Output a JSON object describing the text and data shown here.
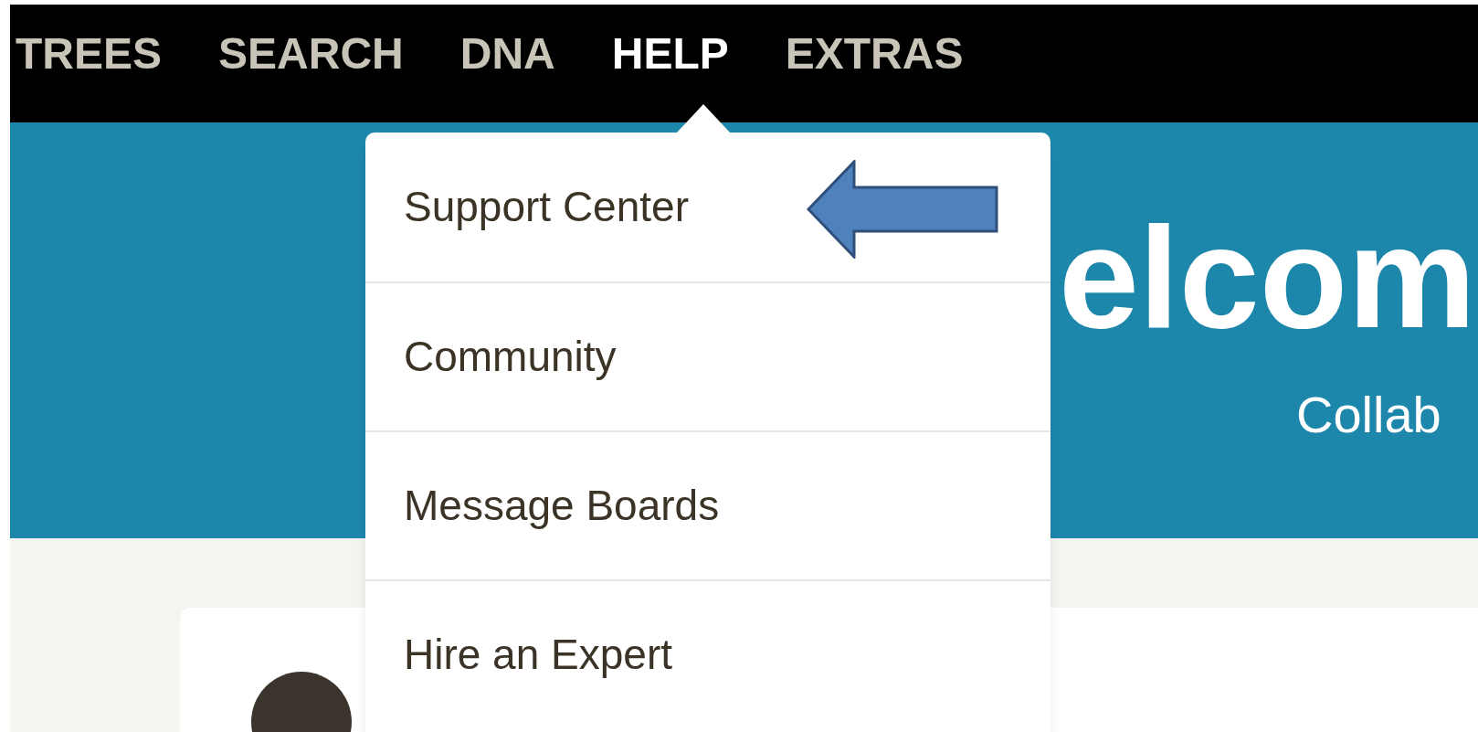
{
  "nav": {
    "items": [
      {
        "label": "TREES",
        "selected": false
      },
      {
        "label": "SEARCH",
        "selected": false
      },
      {
        "label": "DNA",
        "selected": false
      },
      {
        "label": "HELP",
        "selected": true
      },
      {
        "label": "EXTRAS",
        "selected": false
      }
    ]
  },
  "banner": {
    "title": "elcom",
    "subtitle": "Collab"
  },
  "dropdown": {
    "items": [
      {
        "label": "Support Center",
        "highlighted": true
      },
      {
        "label": "Community",
        "highlighted": false
      },
      {
        "label": "Message Boards",
        "highlighted": false
      },
      {
        "label": "Hire an Expert",
        "highlighted": false
      }
    ]
  }
}
